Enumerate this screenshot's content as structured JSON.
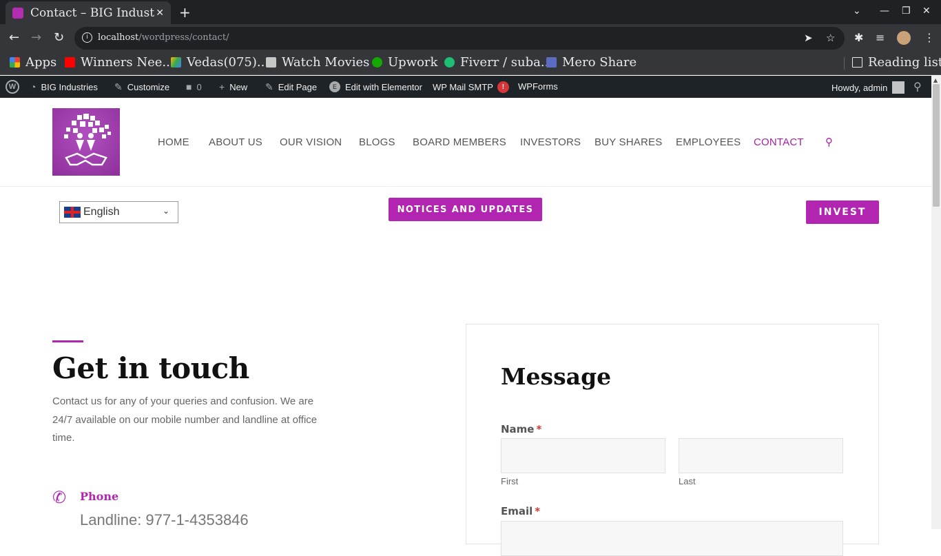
{
  "browser": {
    "tab_title": "Contact – BIG Industr",
    "tab_close": "✕",
    "new_tab": "+",
    "url_host": "localhost",
    "url_path": "/wordpress/contact/",
    "bookmarks": [
      {
        "label": "Apps",
        "icon": "apps-grid-icon",
        "color": "#e8453c"
      },
      {
        "label": "Winners Nee...",
        "icon": "youtube-icon",
        "color": "#ff0000"
      },
      {
        "label": "Vedas(075)...",
        "icon": "google-drive-icon",
        "color": "#fbbc04"
      },
      {
        "label": "Watch Movies",
        "icon": "folder-icon",
        "color": "#c4c7c5"
      },
      {
        "label": "Upwork",
        "icon": "upwork-icon",
        "color": "#14a800"
      },
      {
        "label": "Fiverr / suba...",
        "icon": "fiverr-icon",
        "color": "#1dbf73"
      },
      {
        "label": "Mero Share",
        "icon": "mero-share-icon",
        "color": "#5b6cc2"
      }
    ],
    "reading_list": "Reading list"
  },
  "adminbar": {
    "site_name": "BIG Industries",
    "customize": "Customize",
    "comments_count": "0",
    "new": "New",
    "edit_page": "Edit Page",
    "edit_elementor": "Edit with Elementor",
    "wp_mail_smtp": "WP Mail SMTP",
    "wp_mail_badge": "!",
    "wpforms": "WPForms",
    "howdy": "Howdy, admin"
  },
  "nav": {
    "items": [
      "HOME",
      "ABOUT US",
      "OUR VISION",
      "BLOGS",
      "BOARD MEMBERS",
      "INVESTORS",
      "BUY SHARES",
      "EMPLOYEES",
      "CONTACT"
    ],
    "active": "CONTACT"
  },
  "utility": {
    "language": "English",
    "notices_button": "NOTICES AND UPDATES",
    "invest_button": "INVEST"
  },
  "contact": {
    "heading": "Get in touch",
    "intro": "Contact us for any of your queries and confusion. We are 24/7 available on our mobile number and landline at office time.",
    "phone_title": "Phone",
    "phone_line": "Landline: 977-1-4353846"
  },
  "form": {
    "heading": "Message",
    "name_label": "Name",
    "required_mark": "*",
    "first_label": "First",
    "last_label": "Last",
    "email_label": "Email"
  },
  "colors": {
    "brand": "#b225b0",
    "admin_bar": "#1d2327",
    "chrome_dark": "#202124"
  }
}
